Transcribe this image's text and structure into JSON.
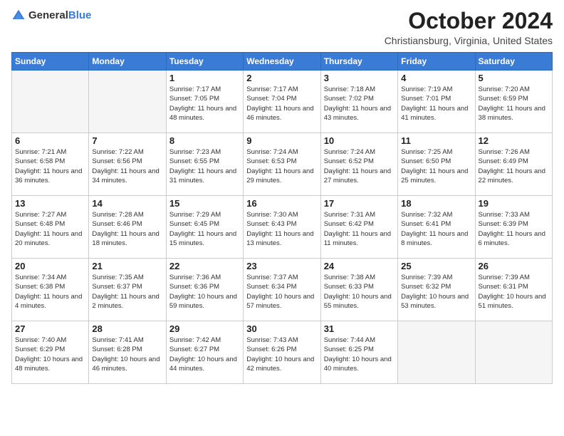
{
  "header": {
    "logo_general": "General",
    "logo_blue": "Blue",
    "title": "October 2024",
    "location": "Christiansburg, Virginia, United States"
  },
  "calendar": {
    "weekdays": [
      "Sunday",
      "Monday",
      "Tuesday",
      "Wednesday",
      "Thursday",
      "Friday",
      "Saturday"
    ],
    "weeks": [
      [
        {
          "day": "",
          "sunrise": "",
          "sunset": "",
          "daylight": ""
        },
        {
          "day": "",
          "sunrise": "",
          "sunset": "",
          "daylight": ""
        },
        {
          "day": "1",
          "sunrise": "Sunrise: 7:17 AM",
          "sunset": "Sunset: 7:05 PM",
          "daylight": "Daylight: 11 hours and 48 minutes."
        },
        {
          "day": "2",
          "sunrise": "Sunrise: 7:17 AM",
          "sunset": "Sunset: 7:04 PM",
          "daylight": "Daylight: 11 hours and 46 minutes."
        },
        {
          "day": "3",
          "sunrise": "Sunrise: 7:18 AM",
          "sunset": "Sunset: 7:02 PM",
          "daylight": "Daylight: 11 hours and 43 minutes."
        },
        {
          "day": "4",
          "sunrise": "Sunrise: 7:19 AM",
          "sunset": "Sunset: 7:01 PM",
          "daylight": "Daylight: 11 hours and 41 minutes."
        },
        {
          "day": "5",
          "sunrise": "Sunrise: 7:20 AM",
          "sunset": "Sunset: 6:59 PM",
          "daylight": "Daylight: 11 hours and 38 minutes."
        }
      ],
      [
        {
          "day": "6",
          "sunrise": "Sunrise: 7:21 AM",
          "sunset": "Sunset: 6:58 PM",
          "daylight": "Daylight: 11 hours and 36 minutes."
        },
        {
          "day": "7",
          "sunrise": "Sunrise: 7:22 AM",
          "sunset": "Sunset: 6:56 PM",
          "daylight": "Daylight: 11 hours and 34 minutes."
        },
        {
          "day": "8",
          "sunrise": "Sunrise: 7:23 AM",
          "sunset": "Sunset: 6:55 PM",
          "daylight": "Daylight: 11 hours and 31 minutes."
        },
        {
          "day": "9",
          "sunrise": "Sunrise: 7:24 AM",
          "sunset": "Sunset: 6:53 PM",
          "daylight": "Daylight: 11 hours and 29 minutes."
        },
        {
          "day": "10",
          "sunrise": "Sunrise: 7:24 AM",
          "sunset": "Sunset: 6:52 PM",
          "daylight": "Daylight: 11 hours and 27 minutes."
        },
        {
          "day": "11",
          "sunrise": "Sunrise: 7:25 AM",
          "sunset": "Sunset: 6:50 PM",
          "daylight": "Daylight: 11 hours and 25 minutes."
        },
        {
          "day": "12",
          "sunrise": "Sunrise: 7:26 AM",
          "sunset": "Sunset: 6:49 PM",
          "daylight": "Daylight: 11 hours and 22 minutes."
        }
      ],
      [
        {
          "day": "13",
          "sunrise": "Sunrise: 7:27 AM",
          "sunset": "Sunset: 6:48 PM",
          "daylight": "Daylight: 11 hours and 20 minutes."
        },
        {
          "day": "14",
          "sunrise": "Sunrise: 7:28 AM",
          "sunset": "Sunset: 6:46 PM",
          "daylight": "Daylight: 11 hours and 18 minutes."
        },
        {
          "day": "15",
          "sunrise": "Sunrise: 7:29 AM",
          "sunset": "Sunset: 6:45 PM",
          "daylight": "Daylight: 11 hours and 15 minutes."
        },
        {
          "day": "16",
          "sunrise": "Sunrise: 7:30 AM",
          "sunset": "Sunset: 6:43 PM",
          "daylight": "Daylight: 11 hours and 13 minutes."
        },
        {
          "day": "17",
          "sunrise": "Sunrise: 7:31 AM",
          "sunset": "Sunset: 6:42 PM",
          "daylight": "Daylight: 11 hours and 11 minutes."
        },
        {
          "day": "18",
          "sunrise": "Sunrise: 7:32 AM",
          "sunset": "Sunset: 6:41 PM",
          "daylight": "Daylight: 11 hours and 8 minutes."
        },
        {
          "day": "19",
          "sunrise": "Sunrise: 7:33 AM",
          "sunset": "Sunset: 6:39 PM",
          "daylight": "Daylight: 11 hours and 6 minutes."
        }
      ],
      [
        {
          "day": "20",
          "sunrise": "Sunrise: 7:34 AM",
          "sunset": "Sunset: 6:38 PM",
          "daylight": "Daylight: 11 hours and 4 minutes."
        },
        {
          "day": "21",
          "sunrise": "Sunrise: 7:35 AM",
          "sunset": "Sunset: 6:37 PM",
          "daylight": "Daylight: 11 hours and 2 minutes."
        },
        {
          "day": "22",
          "sunrise": "Sunrise: 7:36 AM",
          "sunset": "Sunset: 6:36 PM",
          "daylight": "Daylight: 10 hours and 59 minutes."
        },
        {
          "day": "23",
          "sunrise": "Sunrise: 7:37 AM",
          "sunset": "Sunset: 6:34 PM",
          "daylight": "Daylight: 10 hours and 57 minutes."
        },
        {
          "day": "24",
          "sunrise": "Sunrise: 7:38 AM",
          "sunset": "Sunset: 6:33 PM",
          "daylight": "Daylight: 10 hours and 55 minutes."
        },
        {
          "day": "25",
          "sunrise": "Sunrise: 7:39 AM",
          "sunset": "Sunset: 6:32 PM",
          "daylight": "Daylight: 10 hours and 53 minutes."
        },
        {
          "day": "26",
          "sunrise": "Sunrise: 7:39 AM",
          "sunset": "Sunset: 6:31 PM",
          "daylight": "Daylight: 10 hours and 51 minutes."
        }
      ],
      [
        {
          "day": "27",
          "sunrise": "Sunrise: 7:40 AM",
          "sunset": "Sunset: 6:29 PM",
          "daylight": "Daylight: 10 hours and 48 minutes."
        },
        {
          "day": "28",
          "sunrise": "Sunrise: 7:41 AM",
          "sunset": "Sunset: 6:28 PM",
          "daylight": "Daylight: 10 hours and 46 minutes."
        },
        {
          "day": "29",
          "sunrise": "Sunrise: 7:42 AM",
          "sunset": "Sunset: 6:27 PM",
          "daylight": "Daylight: 10 hours and 44 minutes."
        },
        {
          "day": "30",
          "sunrise": "Sunrise: 7:43 AM",
          "sunset": "Sunset: 6:26 PM",
          "daylight": "Daylight: 10 hours and 42 minutes."
        },
        {
          "day": "31",
          "sunrise": "Sunrise: 7:44 AM",
          "sunset": "Sunset: 6:25 PM",
          "daylight": "Daylight: 10 hours and 40 minutes."
        },
        {
          "day": "",
          "sunrise": "",
          "sunset": "",
          "daylight": ""
        },
        {
          "day": "",
          "sunrise": "",
          "sunset": "",
          "daylight": ""
        }
      ]
    ]
  }
}
